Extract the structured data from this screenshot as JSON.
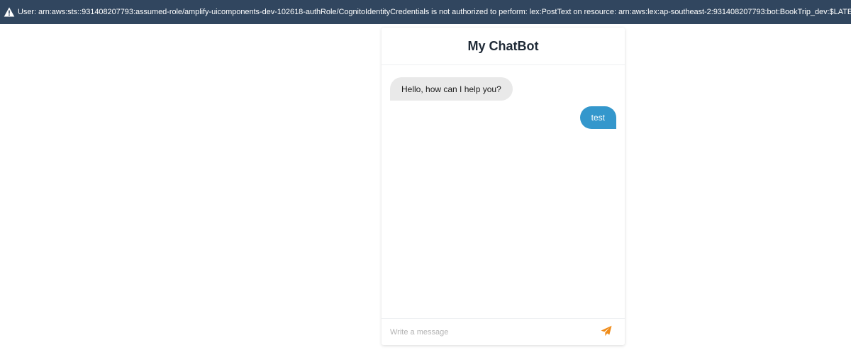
{
  "error_bar": {
    "icon": "warning-triangle-icon",
    "message": "User: arn:aws:sts::931408207793:assumed-role/amplify-uicomponents-dev-102618-authRole/CognitoIdentityCredentials is not authorized to perform: lex:PostText on resource: arn:aws:lex:ap-southeast-2:931408207793:bot:BookTrip_dev:$LATEST",
    "background_color": "#31465f"
  },
  "chat": {
    "title": "My ChatBot",
    "messages": [
      {
        "from": "bot",
        "text": "Hello, how can I help you?"
      },
      {
        "from": "user",
        "text": "test"
      }
    ],
    "composer": {
      "placeholder": "Write a message",
      "value": "",
      "send_icon": "paper-plane-icon"
    },
    "colors": {
      "user_bubble": "#3497cc",
      "bot_bubble": "#e9e9e9",
      "send_icon": "#f08c1a"
    }
  }
}
